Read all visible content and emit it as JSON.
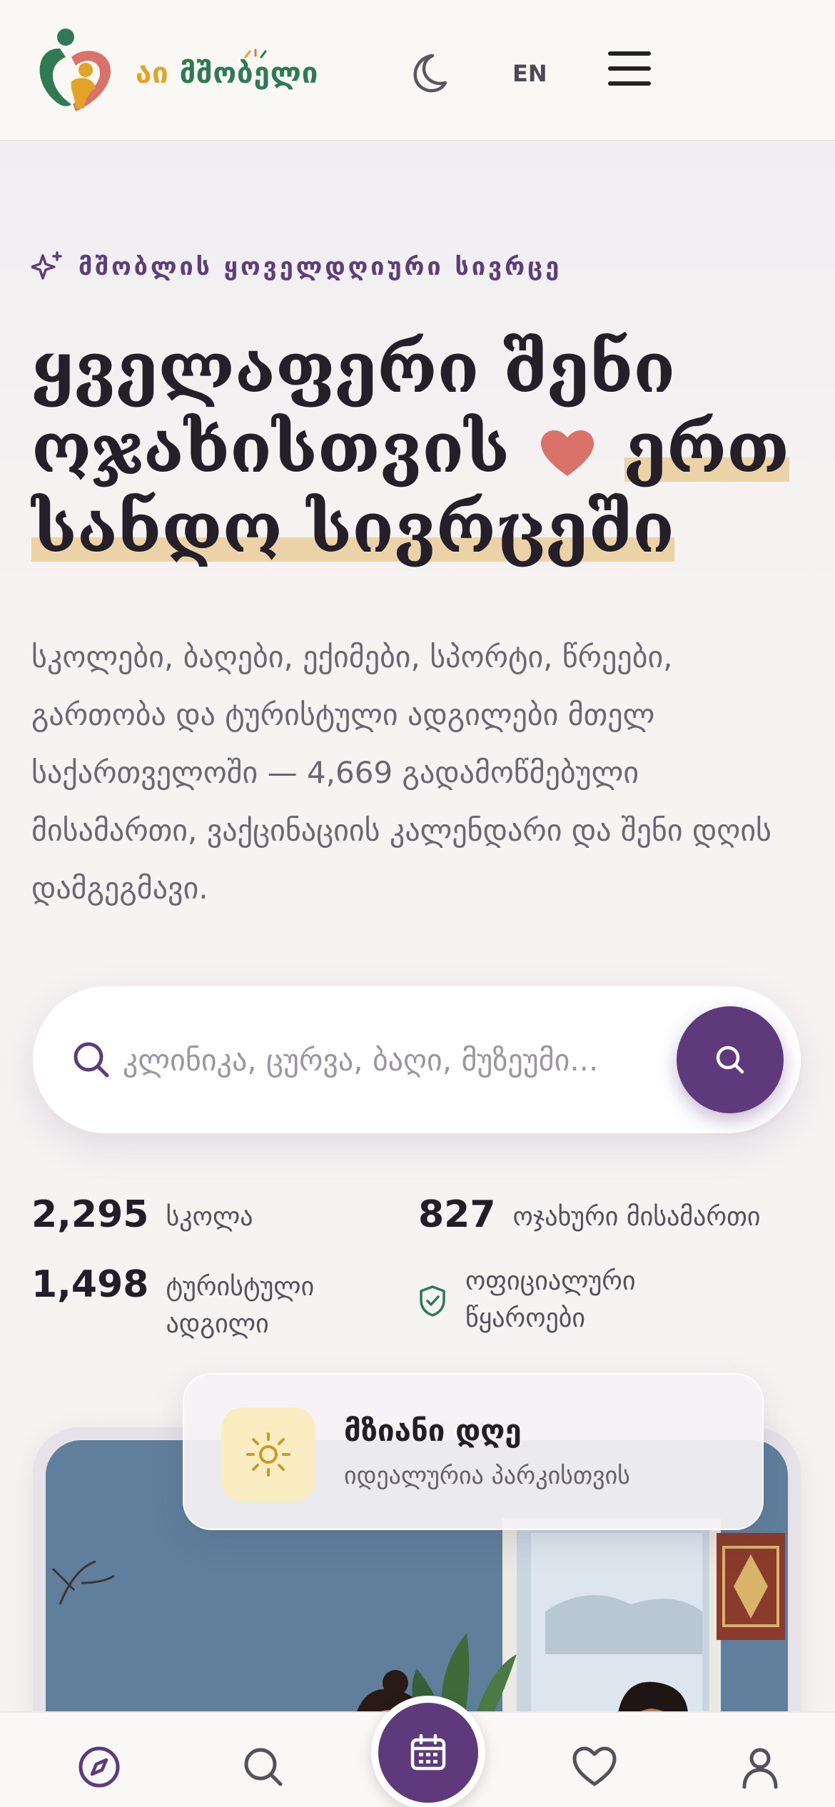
{
  "header": {
    "logo_text_a": "აი",
    "logo_text_b": "მშობელი",
    "lang": "EN"
  },
  "hero": {
    "eyebrow": "მშობლის ყოველდღიური სივრცე",
    "headline_line1": "ყველაფერი შენი",
    "headline_line2_start": "ოჯახისთვის",
    "headline_line2_end": "ერთ",
    "headline_line3": "სანდო სივრცეში",
    "lead": "სკოლები, ბაღები, ექიმები, სპორტი, წრეები, გართობა და ტურისტული ადგილები მთელ საქართველოში — 4,669 გადამოწმებული მისამართი, ვაქცინაციის კალენდარი და შენი დღის დამგეგმავი."
  },
  "search": {
    "placeholder": "კლინიკა, ცურვა, ბაღი, მუზეუმი..."
  },
  "stats": {
    "schools_num": "2,295",
    "schools_label": "სკოლა",
    "family_num": "827",
    "family_label": "ოჯახური მისამართი",
    "tourist_num": "1,498",
    "tourist_label_1": "ტურისტული",
    "tourist_label_2": "ადგილი",
    "official_label_1": "ოფიციალური",
    "official_label_2": "წყაროები"
  },
  "weather": {
    "title": "მზიანი დღე",
    "subtitle": "იდეალურია პარკისთვის"
  },
  "icons": {
    "theme": "moon-icon",
    "menu": "hamburger-icon",
    "nav": [
      "compass-icon",
      "search-icon",
      "calendar-icon",
      "heart-icon",
      "user-icon"
    ]
  },
  "colors": {
    "brand_purple": "#5e3a7d",
    "highlight": "#ecd3a7",
    "heart": "#d9736a",
    "logo_green": "#2f7a55",
    "logo_gold": "#e2a326"
  }
}
